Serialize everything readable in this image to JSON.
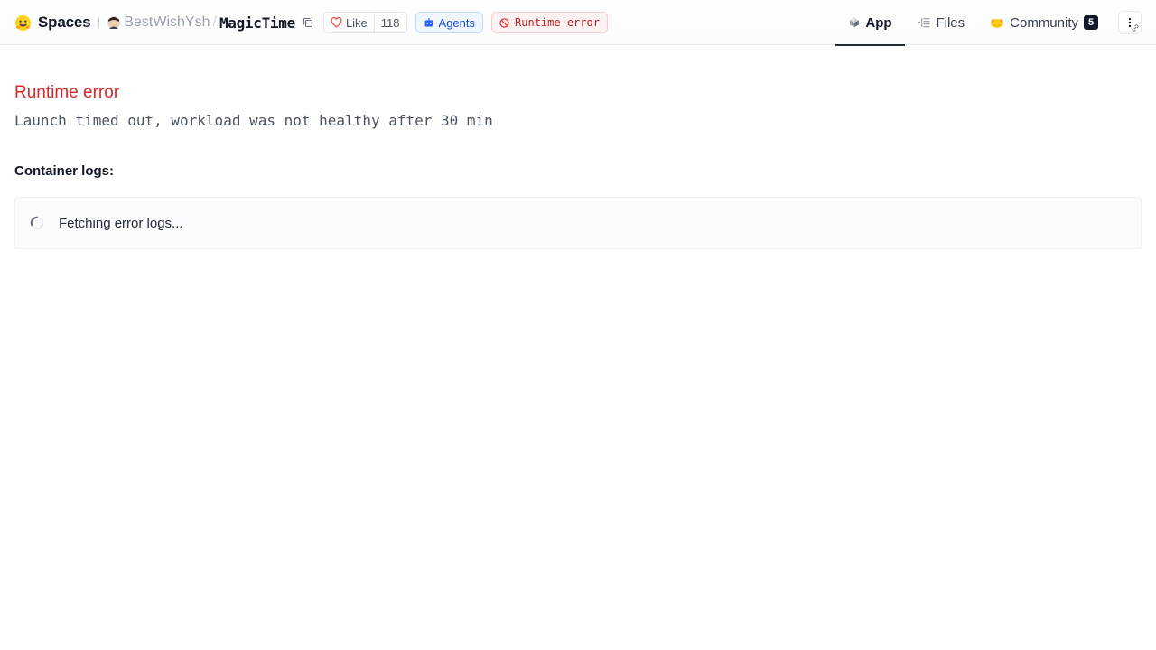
{
  "header": {
    "brand": {
      "label": "Spaces",
      "icon": "hugging-face-logo"
    },
    "owner": {
      "name": "BestWishYsh",
      "icon": "avatar"
    },
    "separator": "/",
    "space_name": "MagicTime",
    "like": {
      "label": "Like",
      "count": "118",
      "icon": "heart-icon"
    },
    "agents": {
      "label": "Agents",
      "icon": "robot-icon"
    },
    "status": {
      "label": "Runtime error",
      "icon": "error-circle-icon"
    },
    "tabs": [
      {
        "label": "App",
        "icon": "cube-icon",
        "active": true
      },
      {
        "label": "Files",
        "icon": "files-icon",
        "active": false
      },
      {
        "label": "Community",
        "icon": "community-hands-icon",
        "active": false,
        "badge": "5"
      }
    ],
    "more_icon": "vertical-dots-icon"
  },
  "main": {
    "error_title": "Runtime error",
    "error_message": "Launch timed out, workload was not healthy after 30 min",
    "logs_label": "Container logs:",
    "logs_status": "Fetching error logs..."
  },
  "colors": {
    "error_red": "#dc2626",
    "agents_blue": "#1d4ed8",
    "text_dark": "#111827",
    "muted_gray": "#9ca3af"
  }
}
